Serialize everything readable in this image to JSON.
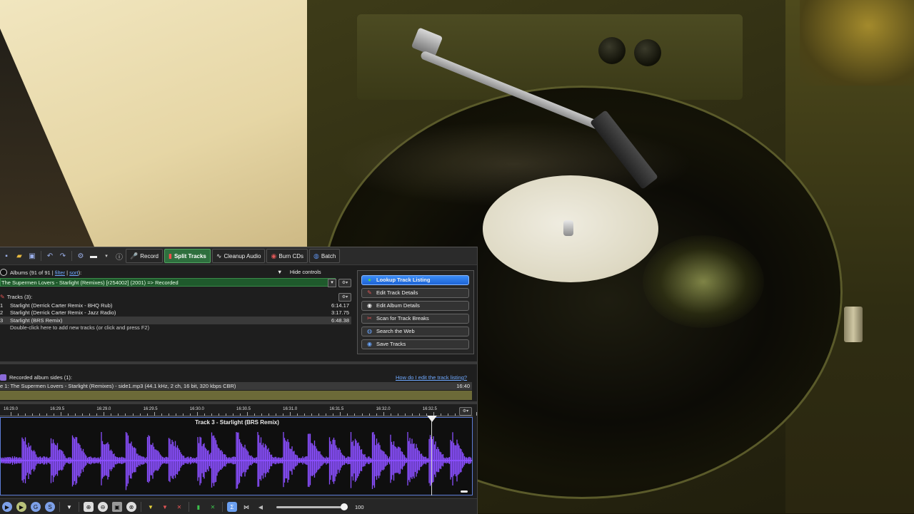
{
  "toolbar": {
    "tabs": [
      {
        "label": "Record",
        "icon": "microphone-icon"
      },
      {
        "label": "Split Tracks",
        "icon": "split-tracks-icon",
        "active": true
      },
      {
        "label": "Cleanup Audio",
        "icon": "waveform-icon"
      },
      {
        "label": "Burn CDs",
        "icon": "cd-icon"
      },
      {
        "label": "Batch",
        "icon": "batch-icon"
      }
    ]
  },
  "albums": {
    "label": "Albums (91 of 91 |",
    "filter_link": "filter",
    "separator": "|",
    "sort_link": "sort",
    "suffix": "):",
    "hide_controls": "Hide controls",
    "selected": "The Supermen Lovers - Starlight (Remixes) [r254002] (2001) => Recorded"
  },
  "tracks": {
    "header": "Tracks (3):",
    "rows": [
      {
        "num": "1",
        "title": "Starlight (Derrick Carter Remix - BHQ Rub)",
        "duration": "6:14.17"
      },
      {
        "num": "2",
        "title": "Starlight (Derrick Carter Remix - Jazz Radio)",
        "duration": "3:17.75"
      },
      {
        "num": "3",
        "title": "Starlight (BRS Remix)",
        "duration": "6:48.38"
      }
    ],
    "hint": "Double-click here to add new tracks (or click and press F2)"
  },
  "actions": [
    {
      "label": "Lookup Track Listing",
      "icon": "lookup-icon",
      "primary": true
    },
    {
      "label": "Edit Track Details",
      "icon": "pencil-icon"
    },
    {
      "label": "Edit Album Details",
      "icon": "record-icon"
    },
    {
      "label": "Scan for Track Breaks",
      "icon": "scan-icon"
    },
    {
      "label": "Search the Web",
      "icon": "globe-icon"
    },
    {
      "label": "Save Tracks",
      "icon": "save-icon"
    }
  ],
  "recorded": {
    "header": "Recorded album sides (1):",
    "help_link": "How do I edit the track listing?",
    "row_text": "e 1: The Supermen Lovers - Starlight (Remixes) - side1.mp3 (44.1 kHz, 2 ch, 16 bit, 320 kbps CBR)",
    "row_duration": "16:40"
  },
  "waveform": {
    "ruler_labels": [
      "16:29.0",
      "16:29.5",
      "16:29.0",
      "16:29.5",
      "16:30.0",
      "16:30.5",
      "16:31.0",
      "16:31.5",
      "16:32.0",
      "16:32.5"
    ],
    "title": "Track 3 - Starlight (BRS Remix)",
    "color": "#8a4fff"
  },
  "bottom": {
    "zoom_value": "100",
    "zoom_fraction": 0.95
  },
  "colors": {
    "accent_blue": "#1d64d6",
    "active_tab_green": "#2e6f3e",
    "album_row_green": "#1f5a2c",
    "wave_purple": "#8a4fff"
  }
}
